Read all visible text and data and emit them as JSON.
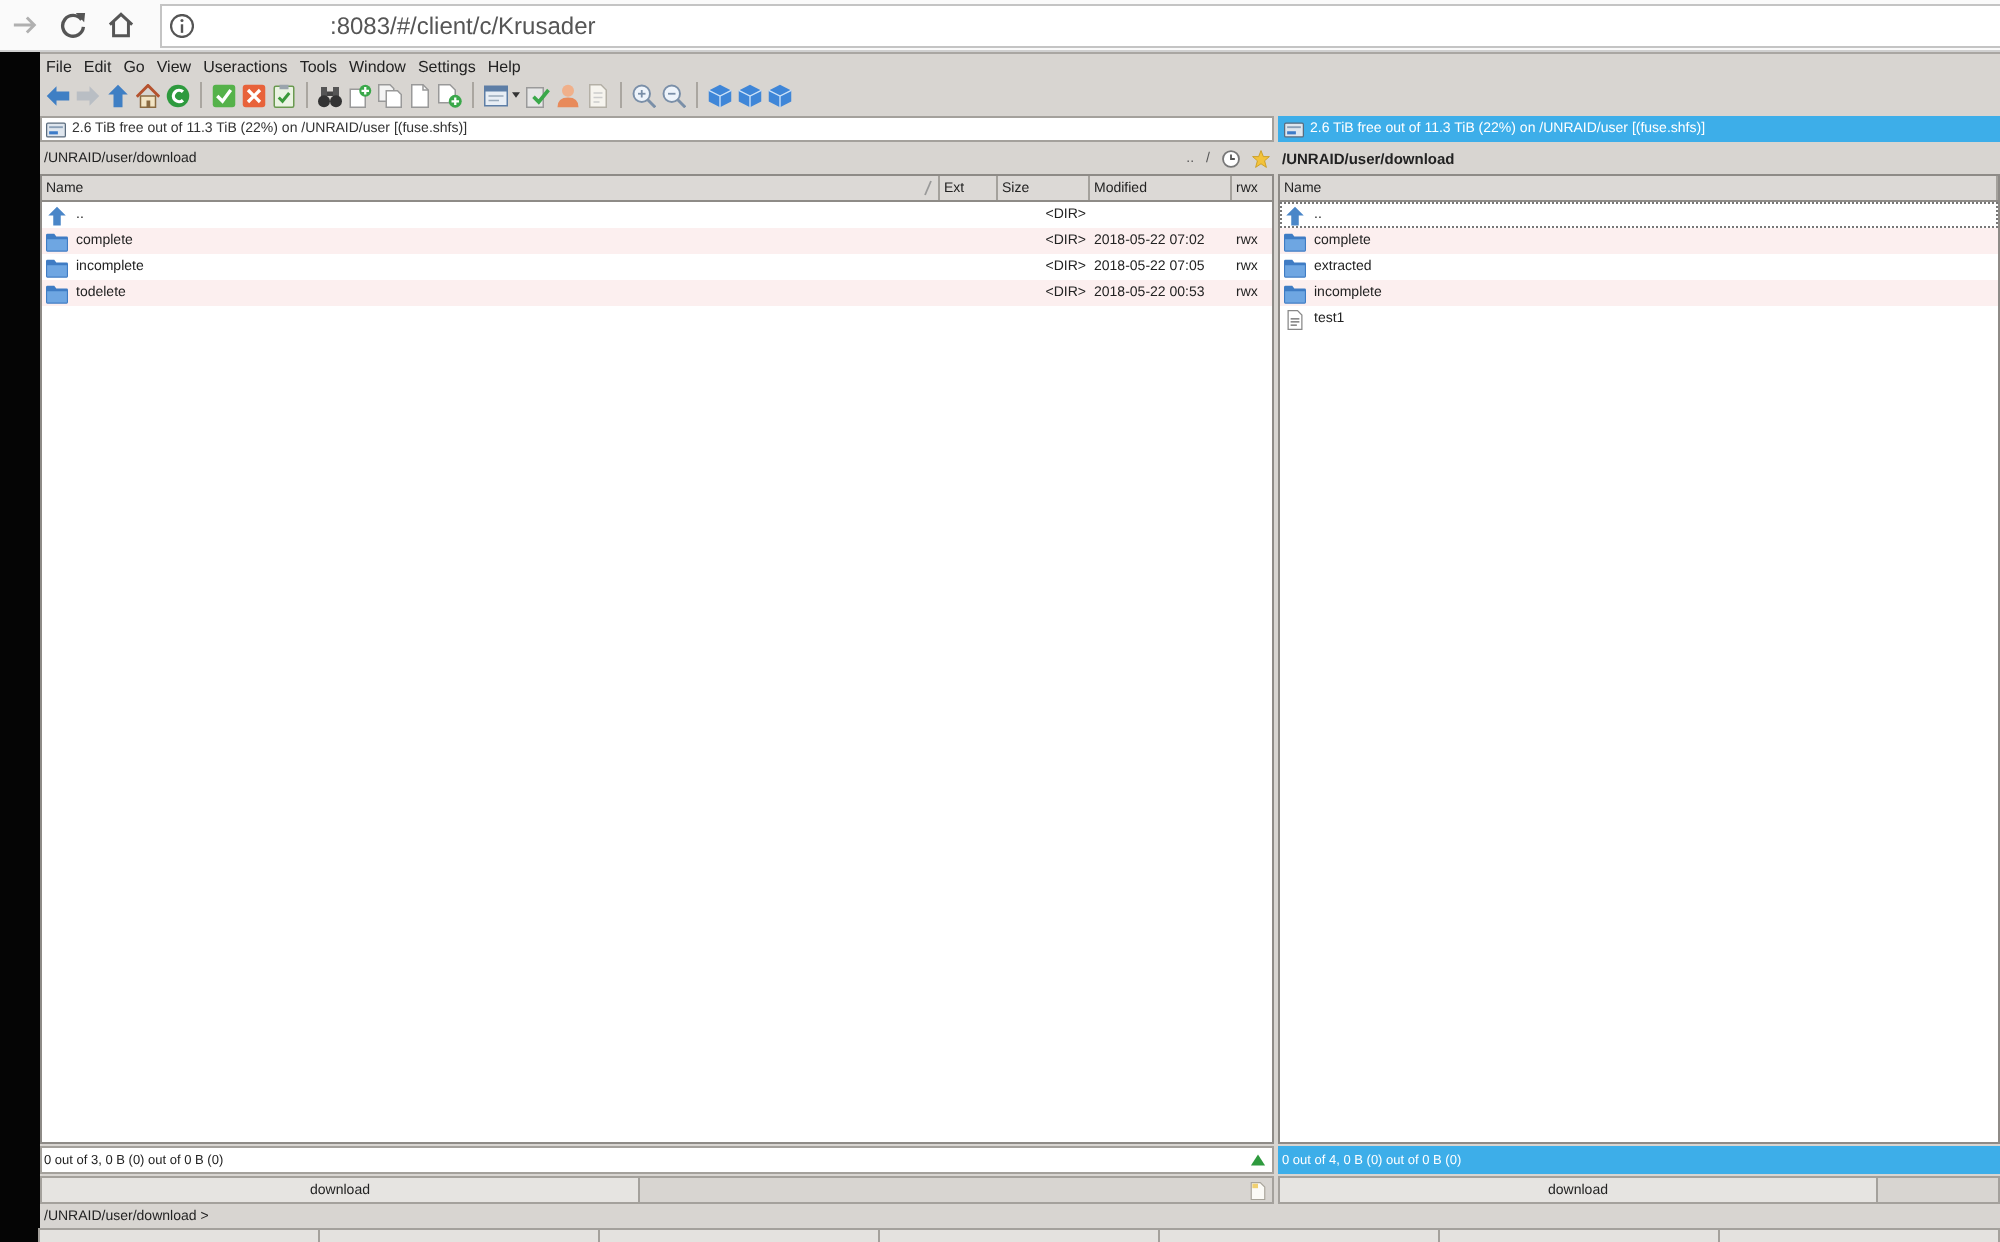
{
  "browser": {
    "url": ":8083/#/client/c/Krusader"
  },
  "menu": [
    "File",
    "Edit",
    "Go",
    "View",
    "Useractions",
    "Tools",
    "Window",
    "Settings",
    "Help"
  ],
  "panels": [
    {
      "active": false,
      "free_space": "2.6 TiB free out of 11.3 TiB (22%) on /UNRAID/user [(fuse.shfs)]",
      "path": "/UNRAID/user/download",
      "path_buttons": [
        {
          "kind": "text",
          "label": ".."
        },
        {
          "kind": "text",
          "label": "/"
        },
        {
          "kind": "history"
        },
        {
          "kind": "bookmarks"
        }
      ],
      "columns": [
        {
          "kind": "name",
          "label": "Name",
          "sorted": true
        },
        {
          "kind": "ext",
          "label": "Ext",
          "sorted": false
        },
        {
          "kind": "size",
          "label": "Size",
          "sorted": false
        },
        {
          "kind": "modified",
          "label": "Modified",
          "sorted": false
        },
        {
          "kind": "rwx",
          "label": "rwx",
          "sorted": false
        }
      ],
      "rows": [
        {
          "kind": "up",
          "name": "..",
          "size": "<DIR>",
          "focused": false
        },
        {
          "kind": "folder",
          "name": "complete",
          "size": "<DIR>",
          "modified": "2018-05-22 07:02",
          "rwx": "rwx",
          "focused": false
        },
        {
          "kind": "folder",
          "name": "incomplete",
          "size": "<DIR>",
          "modified": "2018-05-22 07:05",
          "rwx": "rwx",
          "focused": false
        },
        {
          "kind": "folder",
          "name": "todelete",
          "size": "<DIR>",
          "modified": "2018-05-22 00:53",
          "rwx": "rwx",
          "focused": false
        }
      ],
      "status": "0 out of 3, 0 B (0) out of 0 B (0)",
      "status_icons": [
        {
          "kind": "triangle"
        }
      ],
      "tabs": [
        {
          "label": "download",
          "selected": true
        }
      ],
      "tab_icons": [
        {
          "kind": "page"
        }
      ]
    },
    {
      "active": true,
      "free_space": "2.6 TiB free out of 11.3 TiB (22%) on /UNRAID/user [(fuse.shfs)]",
      "path": "/UNRAID/user/download",
      "columns": [
        {
          "kind": "name",
          "label": "Name"
        }
      ],
      "rows": [
        {
          "kind": "up",
          "name": "..",
          "focused": true
        },
        {
          "kind": "folder",
          "name": "complete",
          "focused": false
        },
        {
          "kind": "folder",
          "name": "extracted",
          "focused": false
        },
        {
          "kind": "folder",
          "name": "incomplete",
          "focused": false
        },
        {
          "kind": "file",
          "name": "test1",
          "focused": false
        }
      ],
      "status": "0 out of 4, 0 B (0) out of 0 B (0)",
      "tabs": [
        {
          "label": "download",
          "selected": true
        }
      ]
    }
  ],
  "command_line": {
    "prompt": "/UNRAID/user/download >"
  }
}
